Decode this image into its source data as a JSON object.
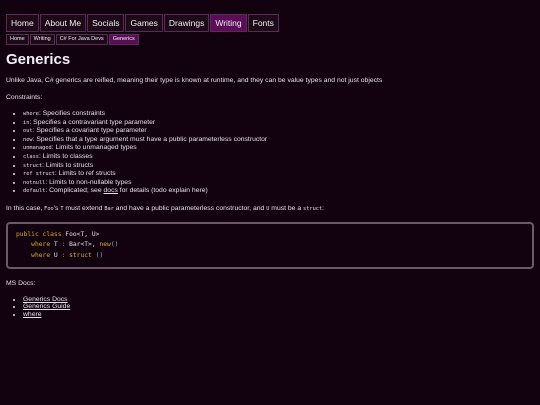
{
  "nav": [
    "Home",
    "About Me",
    "Socials",
    "Games",
    "Drawings",
    "Writing",
    "Fonts"
  ],
  "crumbs": [
    "Home",
    "Writing",
    "C# For Java Devs",
    "Generics"
  ],
  "title": "Generics",
  "intro": "Unlike Java, C# generics are reified, meaning their type is known at runtime, and they can be value types and not just objects",
  "constraints_label": "Constraints:",
  "constraints": [
    {
      "code": "where",
      "text": ": Specifies constraints"
    },
    {
      "code": "in",
      "text": ": Specifies a contravariant type parameter"
    },
    {
      "code": "out",
      "text": ": Specifies a covariant type parameter"
    },
    {
      "code": "new",
      "text": ": Specifies that a type argument must have a public parameterless constructor"
    },
    {
      "code": "unmanaged",
      "text": ": Limits to unmanaged types"
    },
    {
      "code": "class",
      "text": ": Limits to classes"
    },
    {
      "code": "struct",
      "text": ": Limits to structs"
    },
    {
      "code": "ref struct",
      "text": ": Limits to ref structs"
    },
    {
      "code": "notnull",
      "text": ": Limits to non-nullable types"
    },
    {
      "code": "default",
      "text": ": Complicated; see "
    }
  ],
  "default_link": "docs",
  "default_tail": " for details (todo explain here)",
  "case_line": {
    "p1": "In this case, ",
    "c1": "Foo",
    "p2": "'s ",
    "c2": "T",
    "p3": " must extend ",
    "c3": "Bar",
    "p4": " and have a public parameterless constructor, and ",
    "c4": "U",
    "p5": " must be a ",
    "c5": "struct",
    "p6": ":"
  },
  "code": {
    "l1_kw": "public class",
    "l1_rest": " Foo<T, U>",
    "l2_kw": "where",
    "l2_mid": " T ",
    "l2_colon": ":",
    "l2_rest": " Bar<T>, ",
    "l2_new": "new",
    "l2_par": "()",
    "l3_kw": "where",
    "l3_mid": " U ",
    "l3_colon": ":",
    "l3_struct": " struct ",
    "l3_par": "()"
  },
  "msdocs_label": "MS Docs:",
  "msdocs_links": [
    "Generics Docs",
    "Generics Guide",
    "where"
  ]
}
